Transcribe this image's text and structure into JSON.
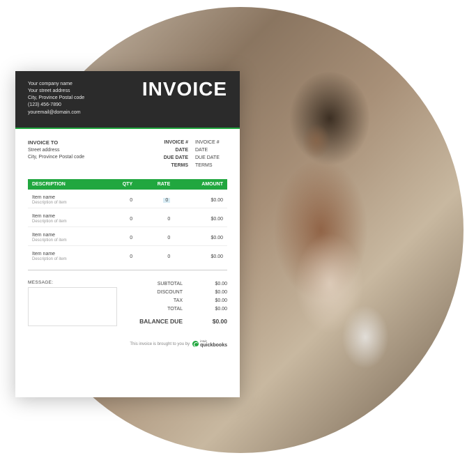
{
  "invoice": {
    "title": "INVOICE",
    "company": {
      "name": "Your company name",
      "street": "Your street address",
      "city": "City, Province  Postal code",
      "phone": "(123) 456-7890",
      "email": "youremail@domain.com"
    },
    "bill_to_title": "INVOICE TO",
    "bill_to": {
      "street": "Street address",
      "city": "City, Province  Postal code"
    },
    "meta": [
      {
        "label": "INVOICE #",
        "value": "INVOICE #"
      },
      {
        "label": "DATE",
        "value": "DATE"
      },
      {
        "label": "DUE DATE",
        "value": "DUE DATE"
      },
      {
        "label": "TERMS",
        "value": "TERMS"
      }
    ],
    "columns": {
      "desc": "DESCRIPTION",
      "qty": "QTY",
      "rate": "RATE",
      "amount": "AMOUNT"
    },
    "items": [
      {
        "name": "Item name",
        "desc": "Description of item",
        "qty": "0",
        "rate": "0",
        "amount": "$0.00"
      },
      {
        "name": "Item name",
        "desc": "Description of item",
        "qty": "0",
        "rate": "0",
        "amount": "$0.00"
      },
      {
        "name": "Item name",
        "desc": "Description of item",
        "qty": "0",
        "rate": "0",
        "amount": "$0.00"
      },
      {
        "name": "Item name",
        "desc": "Description of item",
        "qty": "0",
        "rate": "0",
        "amount": "$0.00"
      }
    ],
    "message_label": "MESSAGE:",
    "totals": [
      {
        "label": "SUBTOTAL",
        "value": "$0.00"
      },
      {
        "label": "DISCOUNT",
        "value": "$0.00"
      },
      {
        "label": "TAX",
        "value": "$0.00"
      },
      {
        "label": "TOTAL",
        "value": "$0.00"
      }
    ],
    "balance": {
      "label": "BALANCE DUE",
      "value": "$0.00"
    },
    "footer_text": "This invoice is brought to you by",
    "brand_parent": "intuit",
    "brand_name": "quickbooks"
  },
  "colors": {
    "accent": "#21a73f",
    "header_bg": "#2b2b2b"
  }
}
